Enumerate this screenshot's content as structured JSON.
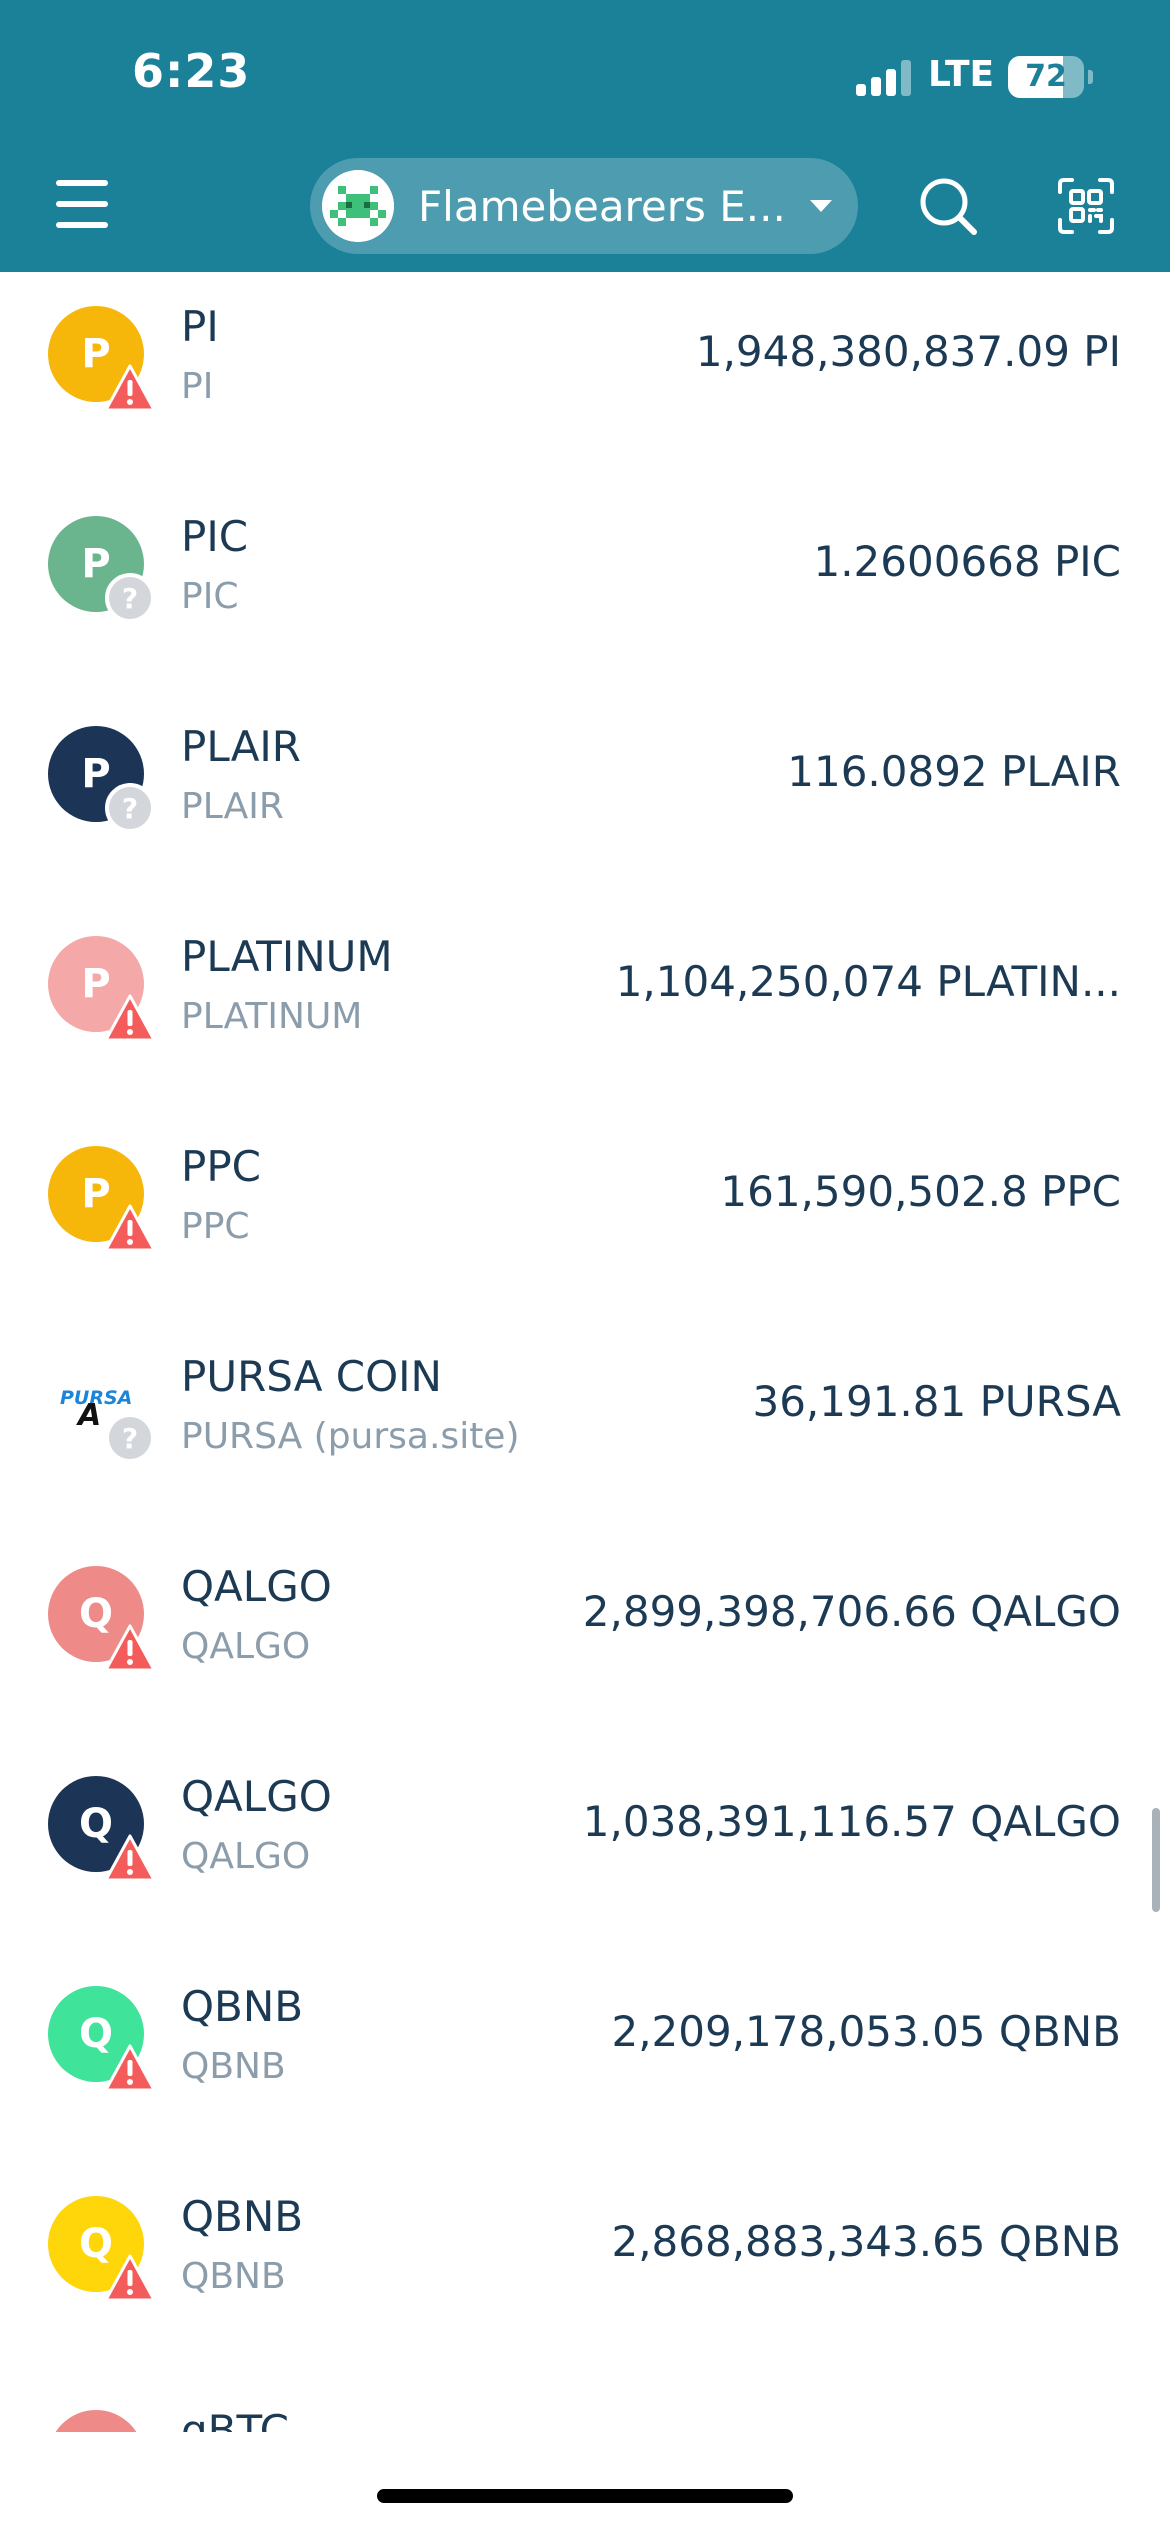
{
  "status_bar": {
    "time": "6:23",
    "network": "LTE",
    "battery_percent": 72,
    "battery_label": "72"
  },
  "header": {
    "account_name": "Flamebearers E...",
    "menu_icon": "hamburger-menu-icon",
    "search_icon": "search-icon",
    "scan_icon": "qr-scan-icon",
    "colors": {
      "background": "#1b8199",
      "text": "#ffffff"
    }
  },
  "tokens": [
    {
      "letter": "P",
      "name": "PI",
      "symbol": "PI",
      "balance": "1,948,380,837.09 PI",
      "icon_color": "#f7b60a",
      "badge": "warning"
    },
    {
      "letter": "P",
      "name": "PIC",
      "symbol": "PIC",
      "balance": "1.2600668 PIC",
      "icon_color": "#6ab58e",
      "badge": "unknown"
    },
    {
      "letter": "P",
      "name": "PLAIR",
      "symbol": "PLAIR",
      "balance": "116.0892 PLAIR",
      "icon_color": "#1c3456",
      "badge": "unknown"
    },
    {
      "letter": "P",
      "name": "PLATINUM",
      "symbol": "PLATINUM",
      "balance": "1,104,250,074 PLATIN...",
      "icon_color": "#f4a8a8",
      "badge": "warning"
    },
    {
      "letter": "P",
      "name": "PPC",
      "symbol": "PPC",
      "balance": "161,590,502.8 PPC",
      "icon_color": "#f7b60a",
      "badge": "warning"
    },
    {
      "letter": "",
      "name": "PURSA COIN",
      "symbol": "PURSA (pursa.site)",
      "balance": "36,191.81 PURSA",
      "icon_color": "#ffffff",
      "badge": "unknown",
      "logo_text": "PURSA",
      "logo_letter": "A"
    },
    {
      "letter": "Q",
      "name": "QALGO",
      "symbol": "QALGO",
      "balance": "2,899,398,706.66 QALGO",
      "icon_color": "#ee8a87",
      "badge": "warning"
    },
    {
      "letter": "Q",
      "name": "QALGO",
      "symbol": "QALGO",
      "balance": "1,038,391,116.57 QALGO",
      "icon_color": "#1c3456",
      "badge": "warning"
    },
    {
      "letter": "Q",
      "name": "QBNB",
      "symbol": "QBNB",
      "balance": "2,209,178,053.05 QBNB",
      "icon_color": "#3fe39a",
      "badge": "warning"
    },
    {
      "letter": "Q",
      "name": "QBNB",
      "symbol": "QBNB",
      "balance": "2,868,883,343.65 QBNB",
      "icon_color": "#ffd60a",
      "badge": "warning"
    }
  ],
  "partial_token": {
    "name": "qBTC",
    "icon_color": "#ee8a87"
  },
  "badges": {
    "warning_color": "#f45b5b",
    "unknown_color": "#d3d7db"
  }
}
